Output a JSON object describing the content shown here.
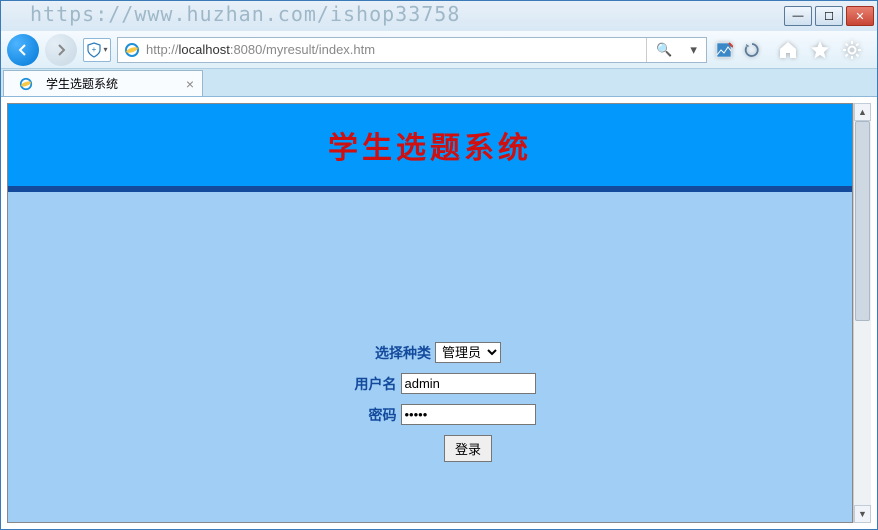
{
  "watermark": "https://www.huzhan.com/ishop33758",
  "window": {
    "minimize": "—",
    "maximize": "☐",
    "close": "✕"
  },
  "nav": {
    "url_prefix": "http://",
    "url_host": "localhost",
    "url_rest": ":8080/myresult/index.htm",
    "search_glyph": "🔍",
    "dropdown_glyph": "▾",
    "refresh_glyph": "↻"
  },
  "tab": {
    "title": "学生选题系统",
    "close": "×"
  },
  "page": {
    "header_title": "学生选题系统",
    "form": {
      "type_label": "选择种类",
      "type_options": [
        "管理员"
      ],
      "type_selected": "管理员",
      "user_label": "用户名",
      "user_value": "admin",
      "pass_label": "密码",
      "pass_value": "•••••",
      "submit_label": "登录"
    }
  }
}
